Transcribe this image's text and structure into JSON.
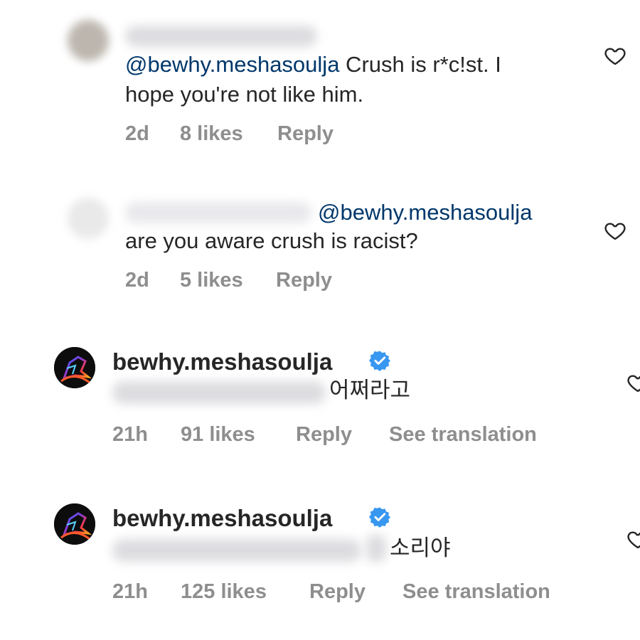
{
  "comments": [
    {
      "mention": "@bewhy.meshasoulja",
      "text_line1": " Crush is r*c!st. I",
      "text_line2": "hope you're not like him.",
      "time": "2d",
      "likes": "8 likes",
      "reply": "Reply"
    },
    {
      "mention": "@bewhy.meshasoulja",
      "text_line2": "are you aware crush is racist?",
      "time": "2d",
      "likes": "5 likes",
      "reply": "Reply"
    },
    {
      "username": "bewhy.meshasoulja",
      "text": "어쩌라고",
      "time": "21h",
      "likes": "91 likes",
      "reply": "Reply",
      "translate": "See translation"
    },
    {
      "username": "bewhy.meshasoulja",
      "text": "소리야",
      "time": "21h",
      "likes": "125 likes",
      "reply": "Reply",
      "translate": "See translation"
    }
  ],
  "icons": {
    "like": "heart-outline-icon",
    "verified": "verified-badge-icon"
  },
  "colors": {
    "mention": "#00376b",
    "meta": "#8e8e8e",
    "verified": "#3897f0"
  }
}
